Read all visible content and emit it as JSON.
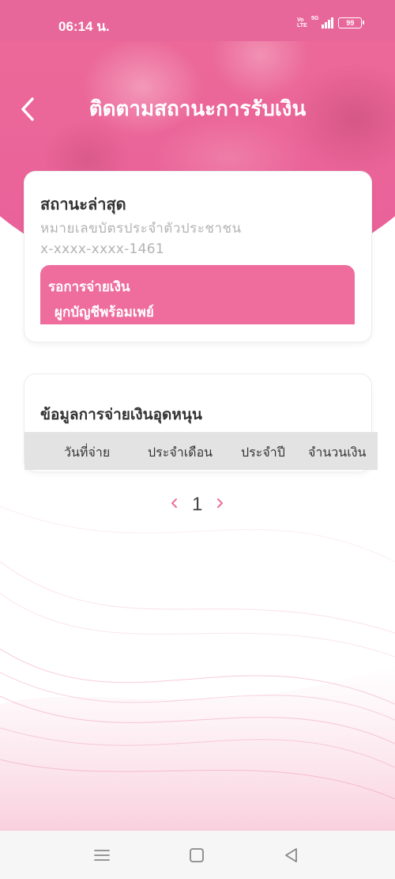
{
  "status_bar": {
    "time": "06:14 น.",
    "network_label": "5G",
    "volte_label": "Vo LTE",
    "battery": "99"
  },
  "header": {
    "title": "ติดตามสถานะการรับเงิน",
    "back_icon": "chevron-left-icon"
  },
  "status_card": {
    "label": "สถานะล่าสุด",
    "id_label": "หมายเลขบัตรประจำตัวประชาชน",
    "id_value": "x-xxxx-xxxx-1461",
    "status_line1": "รอการจ่ายเงิน",
    "status_line2": "ผูกบัญชีพร้อมเพย์",
    "status_color": "#ee6d9d"
  },
  "payment_card": {
    "title": "ข้อมูลการจ่ายเงินอุดหนุน",
    "columns": [
      "วันที่จ่าย",
      "ประจำเดือน",
      "ประจำปี",
      "จำนวนเงิน"
    ]
  },
  "pagination": {
    "current_page": "1",
    "prev_icon": "chevron-left-icon",
    "next_icon": "chevron-right-icon"
  },
  "nav_bar": {
    "buttons": [
      "menu-icon",
      "home-square-icon",
      "back-triangle-icon"
    ]
  },
  "colors": {
    "brand_pink": "#e8679a",
    "accent_pink": "#ee6d9d"
  }
}
